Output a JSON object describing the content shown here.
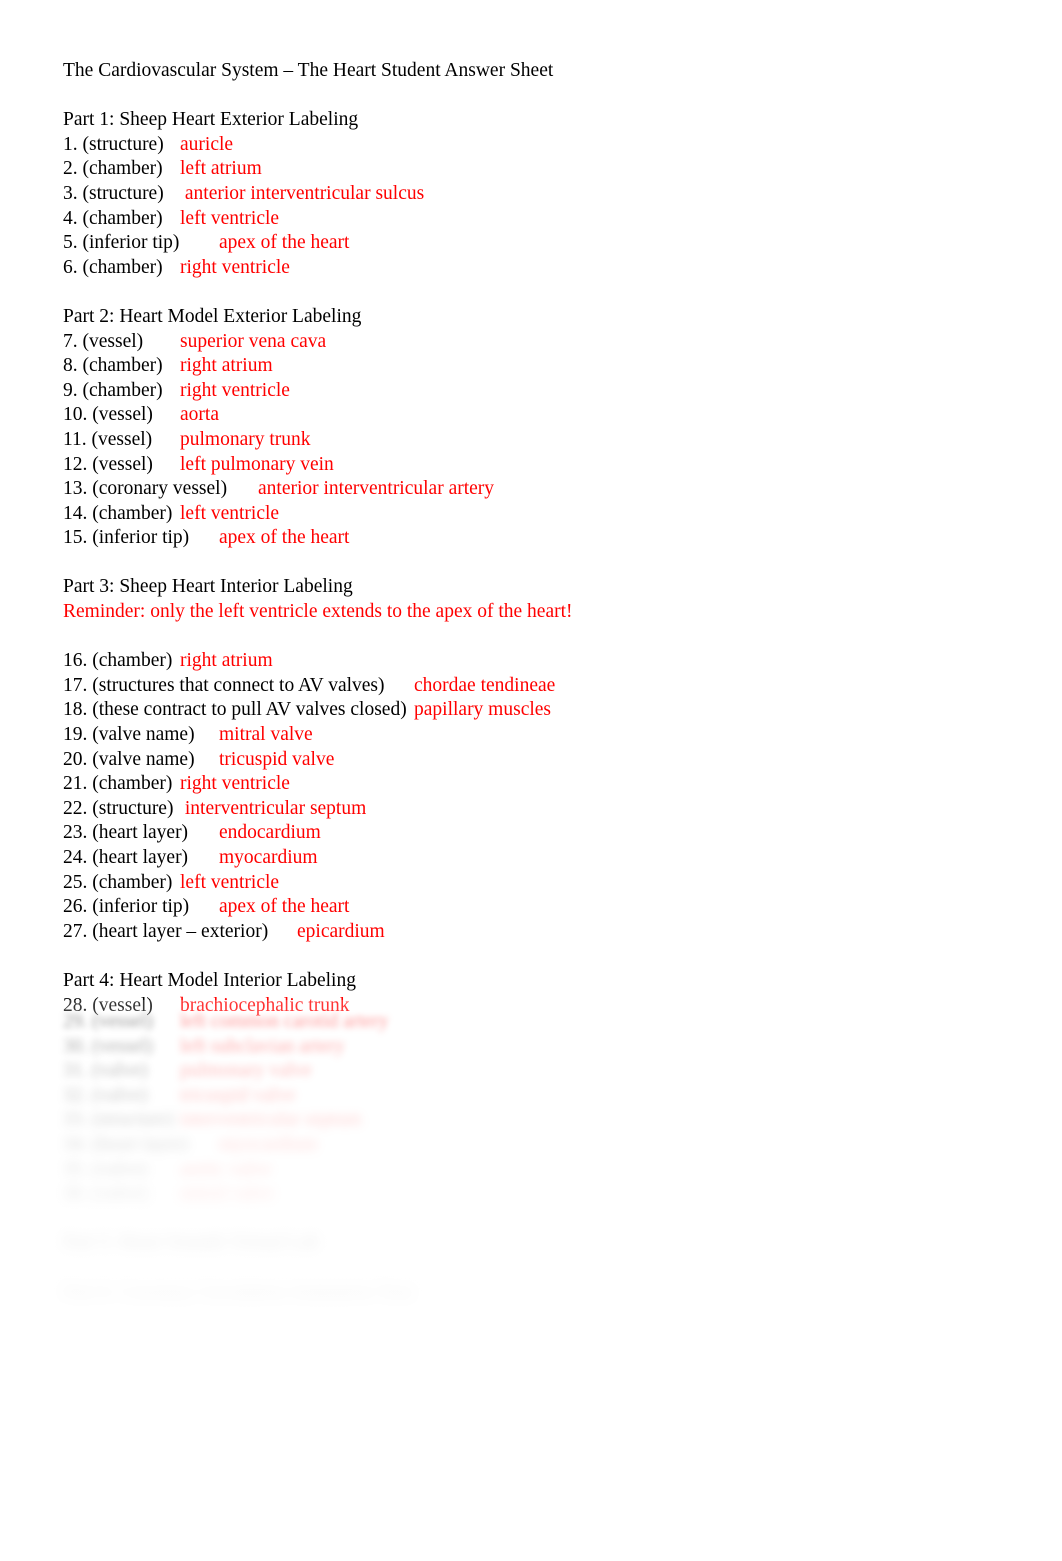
{
  "document": {
    "title": "The Cardiovascular System – The Heart Student Answer Sheet",
    "answer_color": "#ff0000",
    "text_color": "#000000",
    "background_color": "#ffffff"
  },
  "parts": {
    "part1": {
      "heading": "Part 1: Sheep Heart Exterior Labeling",
      "items": [
        {
          "prompt": "1. (structure)",
          "gap": "\t",
          "answer": "auricle"
        },
        {
          "prompt": "2. (chamber)",
          "gap": "\t",
          "answer": "left atrium"
        },
        {
          "prompt": "3. (structure)",
          "gap": "\t",
          "answer": " anterior interventricular sulcus"
        },
        {
          "prompt": "4. (chamber)",
          "gap": "\t",
          "answer": "left ventricle"
        },
        {
          "prompt": "5. (inferior tip)",
          "gap": "\t",
          "answer": "apex of the heart"
        },
        {
          "prompt": "6. (chamber)",
          "gap": "\t",
          "answer": "right ventricle"
        }
      ]
    },
    "part2": {
      "heading": "Part 2: Heart Model Exterior Labeling",
      "items": [
        {
          "prompt": "7. (vessel)",
          "gap": "\t",
          "answer": "superior vena cava"
        },
        {
          "prompt": "8. (chamber)",
          "gap": "\t",
          "answer": "right atrium"
        },
        {
          "prompt": "9. (chamber)",
          "gap": "\t",
          "answer": "right ventricle"
        },
        {
          "prompt": "10. (vessel)",
          "gap": "\t",
          "answer": "aorta"
        },
        {
          "prompt": "11. (vessel)",
          "gap": "\t",
          "answer": "pulmonary trunk"
        },
        {
          "prompt": "12. (vessel)",
          "gap": "\t",
          "answer": "left pulmonary vein"
        },
        {
          "prompt": "13. (coronary vessel)",
          "gap": "\t",
          "answer": "anterior interventricular artery"
        },
        {
          "prompt": "14. (chamber)",
          "gap": "\t",
          "answer": "left ventricle"
        },
        {
          "prompt": "15. (inferior tip)",
          "gap": "\t",
          "answer": "apex of the heart"
        }
      ]
    },
    "part3": {
      "heading": "Part 3: Sheep Heart Interior Labeling",
      "reminder": "Reminder: only the left ventricle extends to the apex of the heart!",
      "items": [
        {
          "prompt": "16. (chamber)",
          "gap": "\t",
          "answer": "right atrium"
        },
        {
          "prompt": "17. (structures that connect to AV valves)",
          "gap": "\t",
          "answer": "chordae tendineae"
        },
        {
          "prompt": "18. (these contract to pull AV valves closed)",
          "gap": "\t",
          "answer": "papillary muscles"
        },
        {
          "prompt": "19. (valve name)",
          "gap": "\t",
          "answer": "mitral valve"
        },
        {
          "prompt": "20. (valve name)",
          "gap": "\t",
          "answer": "tricuspid valve"
        },
        {
          "prompt": "21. (chamber)",
          "gap": "\t",
          "answer": "right ventricle"
        },
        {
          "prompt": "22. (structure)",
          "gap": "\t",
          "answer": " interventricular septum"
        },
        {
          "prompt": "23. (heart layer)",
          "gap": "\t",
          "answer": "endocardium"
        },
        {
          "prompt": "24. (heart layer)",
          "gap": "\t",
          "answer": "myocardium"
        },
        {
          "prompt": "25. (chamber)",
          "gap": "\t",
          "answer": "left ventricle"
        },
        {
          "prompt": "26. (inferior tip)",
          "gap": "\t",
          "answer": "apex of the heart"
        },
        {
          "prompt": "27. (heart layer – exterior)",
          "gap": "\t",
          "answer": "epicardium"
        }
      ]
    },
    "part4": {
      "heading": "Part 4: Heart Model Interior Labeling",
      "items": [
        {
          "prompt": "28. (vessel)",
          "gap": "\t",
          "answer": "brachiocephalic trunk"
        }
      ]
    }
  },
  "gated_section": {
    "note": "lower portion of the page is blurred / obscured and not legible",
    "lines": [
      {
        "prompt": "29. (vessel)",
        "gap": "\t",
        "answer": "left common carotid artery",
        "blur": 1
      },
      {
        "prompt": "30. (vessel)",
        "gap": "\t",
        "answer": "left subclavian artery",
        "blur": 2
      },
      {
        "prompt": "31. (valve)",
        "gap": "\t",
        "answer": "pulmonary valve",
        "blur": 3
      },
      {
        "prompt": "32. (valve)",
        "gap": "\t",
        "answer": "tricuspid valve",
        "blur": 4
      },
      {
        "prompt": "33. (structure)",
        "gap": "\t",
        "answer": "interventricular septum",
        "blur": 5
      },
      {
        "prompt": "34. (heart layer)",
        "gap": "\t",
        "answer": "myocardium",
        "blur": 6
      },
      {
        "prompt": "35. (valve)",
        "gap": "\t",
        "answer": "aortic valve",
        "blur": 7
      },
      {
        "prompt": "36. (valve)",
        "gap": "\t",
        "answer": "mitral valve",
        "blur": 8
      }
    ],
    "headings": [
      {
        "text": "Part 5: Heart Sounds Virtual Lab",
        "blur": 9
      },
      {
        "text": "Part 6: Coronary Circulation Animation Tour",
        "blur": 10
      }
    ]
  }
}
